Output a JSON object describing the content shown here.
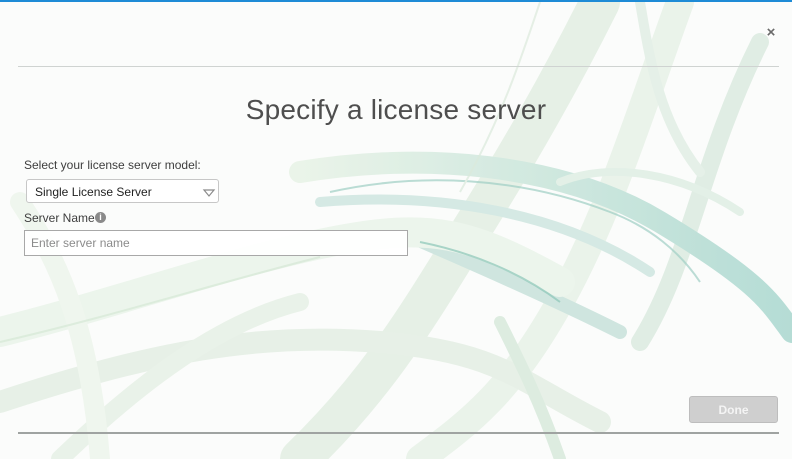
{
  "dialog": {
    "title": "Specify a license server",
    "close_symbol": "×",
    "close_icon": "close-icon"
  },
  "form": {
    "model_label": "Select your license server model:",
    "model_selected": "Single License Server",
    "server_name_label": "Server Name",
    "info_symbol": "i",
    "info_icon": "info-icon",
    "server_name_value": "",
    "server_name_placeholder": "Enter server name"
  },
  "actions": {
    "done_label": "Done",
    "done_enabled": false
  },
  "colors": {
    "accent_bar": "#1e8bd6",
    "title_text": "#4e4e4e",
    "done_disabled_bg": "#cfcfcf",
    "done_disabled_text": "#f4f4f4"
  }
}
